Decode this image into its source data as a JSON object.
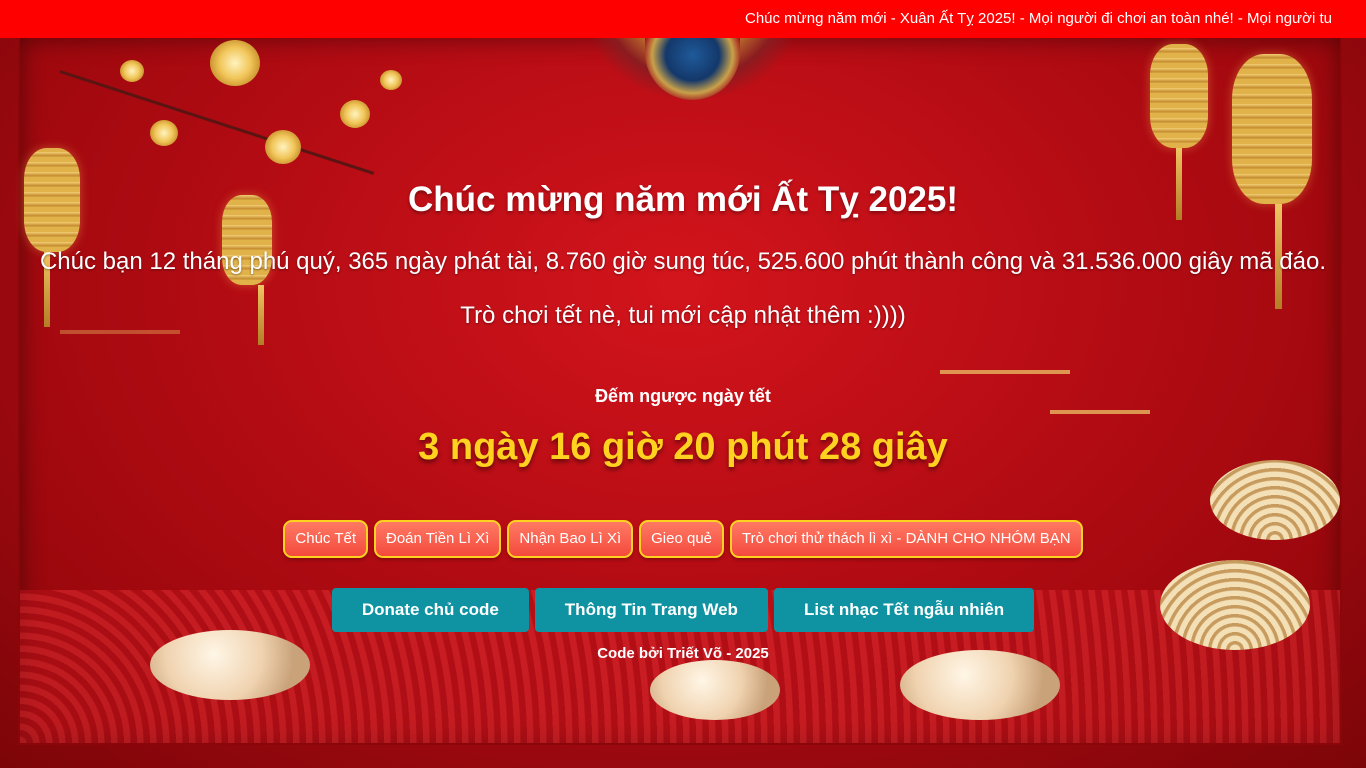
{
  "marquee": {
    "text": "Chúc mừng năm mới - Xuân Ất Tỵ 2025! - Mọi người đi chơi an toàn nhé! - Mọi người tu"
  },
  "hero": {
    "title": "Chúc mừng năm mới Ất Tỵ 2025!",
    "wish": "Chúc bạn 12 tháng phú quý, 365 ngày phát tài, 8.760 giờ sung túc, 525.600 phút thành công và 31.536.000 giây mã đáo.",
    "subline": "Trò chơi tết nè, tui mới cập nhật thêm :))))"
  },
  "countdown": {
    "label": "Đếm ngược ngày tết",
    "value": "3 ngày 16 giờ 20 phút 28 giây"
  },
  "games": [
    {
      "label": "Chúc Tết"
    },
    {
      "label": "Đoán Tiền Lì Xì"
    },
    {
      "label": "Nhận Bao Lì Xì"
    },
    {
      "label": "Gieo quẻ"
    },
    {
      "label": "Trò chơi thử thách lì xì - DÀNH CHO NHÓM BẠN"
    }
  ],
  "actions": [
    {
      "label": "Donate chủ code"
    },
    {
      "label": "Thông Tin Trang Web"
    },
    {
      "label": "List nhạc Tết ngẫu nhiên"
    }
  ],
  "footer": {
    "text": "Code bởi Triết Võ - 2025"
  },
  "colors": {
    "marquee_bg": "#ff0000",
    "background_red": "#b20b13",
    "countdown_gold": "#ffd21f",
    "game_button": "#f44a3e",
    "action_button": "#0f93a2"
  }
}
